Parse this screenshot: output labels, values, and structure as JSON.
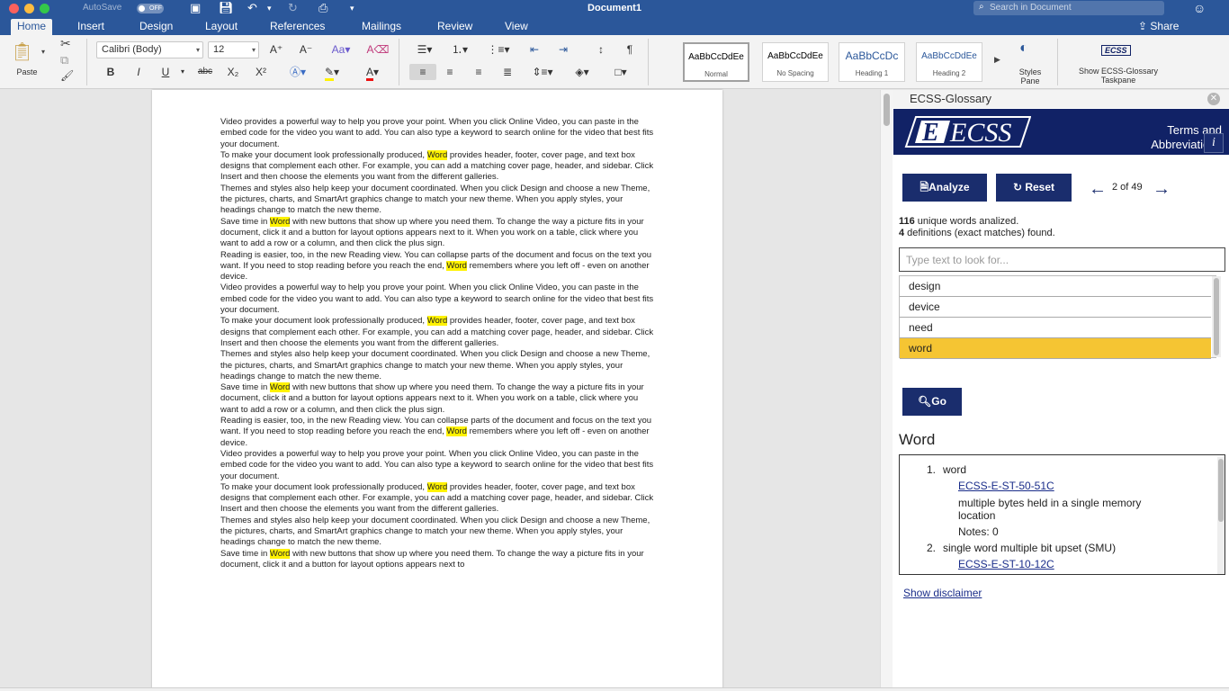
{
  "titlebar": {
    "autosave": "AutoSave",
    "autosave_state": "OFF",
    "doc_title": "Document1",
    "search_placeholder": "Search in Document",
    "smiley": "☺"
  },
  "tabs": [
    "Home",
    "Insert",
    "Design",
    "Layout",
    "References",
    "Mailings",
    "Review",
    "View"
  ],
  "share": "Share",
  "ribbon": {
    "paste": "Paste",
    "font": "Calibri (Body)",
    "size": "12",
    "bold": "B",
    "italic": "I",
    "underline": "U",
    "strike": "abc",
    "sub": "X₂",
    "sup": "X²",
    "styles": [
      {
        "sample": "AaBbCcDdEe",
        "name": "Normal"
      },
      {
        "sample": "AaBbCcDdEe",
        "name": "No Spacing"
      },
      {
        "sample": "AaBbCcDc",
        "name": "Heading 1"
      },
      {
        "sample": "AaBbCcDdEe",
        "name": "Heading 2"
      }
    ],
    "styles_pane": "Styles\nPane",
    "show_ecss": "Show ECSS-Glossary\nTaskpane"
  },
  "document": {
    "paragraphs": [
      "Video provides a powerful way to help you prove your point. When you click Online Video, you can paste in the embed code for the video you want to add. You can also type a keyword to search online for the video that best fits your document.",
      "To make your document look professionally produced, [[Word]] provides header, footer, cover page, and text box designs that complement each other. For example, you can add a matching cover page, header, and sidebar. Click Insert and then choose the elements you want from the different galleries.",
      "Themes and styles also help keep your document coordinated. When you click Design and choose a new Theme, the pictures, charts, and SmartArt graphics change to match your new theme. When you apply styles, your headings change to match the new theme.",
      "Save time in [[Word]] with new buttons that show up where you need them. To change the way a picture fits in your document, click it and a button for layout options appears next to it. When you work on a table, click where you want to add a row or a column, and then click the plus sign.",
      "Reading is easier, too, in the new Reading view. You can collapse parts of the document and focus on the text you want. If you need to stop reading before you reach the end, [[Word]] remembers where you left off - even on another device.",
      "Video provides a powerful way to help you prove your point. When you click Online Video, you can paste in the embed code for the video you want to add. You can also type a keyword to search online for the video that best fits your document.",
      "To make your document look professionally produced, [[Word]] provides header, footer, cover page, and text box designs that complement each other. For example, you can add a matching cover page, header, and sidebar. Click Insert and then choose the elements you want from the different galleries.",
      "Themes and styles also help keep your document coordinated. When you click Design and choose a new Theme, the pictures, charts, and SmartArt graphics change to match your new theme. When you apply styles, your headings change to match the new theme.",
      "Save time in [[Word]] with new buttons that show up where you need them. To change the way a picture fits in your document, click it and a button for layout options appears next to it. When you work on a table, click where you want to add a row or a column, and then click the plus sign.",
      "Reading is easier, too, in the new Reading view. You can collapse parts of the document and focus on the text you want. If you need to stop reading before you reach the end, [[Word]] remembers where you left off - even on another device.",
      "Video provides a powerful way to help you prove your point. When you click Online Video, you can paste in the embed code for the video you want to add. You can also type a keyword to search online for the video that best fits your document.",
      "To make your document look professionally produced, [[Word]] provides header, footer, cover page, and text box designs that complement each other. For example, you can add a matching cover page, header, and sidebar. Click Insert and then choose the elements you want from the different galleries.",
      "Themes and styles also help keep your document coordinated. When you click Design and choose a new Theme, the pictures, charts, and SmartArt graphics change to match your new theme. When you apply styles, your headings change to match the new theme.",
      "Save time in [[Word]] with new buttons that show up where you need them. To change the way a picture fits in your document, click it and a button for layout options appears next to"
    ]
  },
  "taskpane": {
    "title": "ECSS-Glossary",
    "logo_text": "ECSS",
    "banner_line1": "Terms and",
    "banner_line2": "Abbreviations",
    "analyze": "Analyze",
    "reset": "Reset",
    "counter": "2 of 49",
    "stats_count": "116",
    "stats_text": " unique words analized.",
    "defs_count": "4",
    "defs_text": " definitions (exact matches) found.",
    "search_placeholder": "Type text to look for...",
    "words": [
      "design",
      "device",
      "need",
      "word"
    ],
    "selected_word": "word",
    "go": "Go",
    "result_heading": "Word",
    "results": [
      {
        "num": "1.",
        "term": "word",
        "ref": "ECSS-E-ST-50-51C",
        "def1": "multiple bytes held in a single memory",
        "def2": "location",
        "notes": "Notes: 0"
      },
      {
        "num": "2.",
        "term": "single word multiple bit upset (SMU)",
        "ref": "ECSS-E-ST-10-12C"
      }
    ],
    "disclaimer": "Show disclaimer"
  },
  "colors": {
    "accent": "#2b579a",
    "ecss_blue": "#112266",
    "highlight": "#fff200",
    "selected_word": "#f5c533"
  }
}
